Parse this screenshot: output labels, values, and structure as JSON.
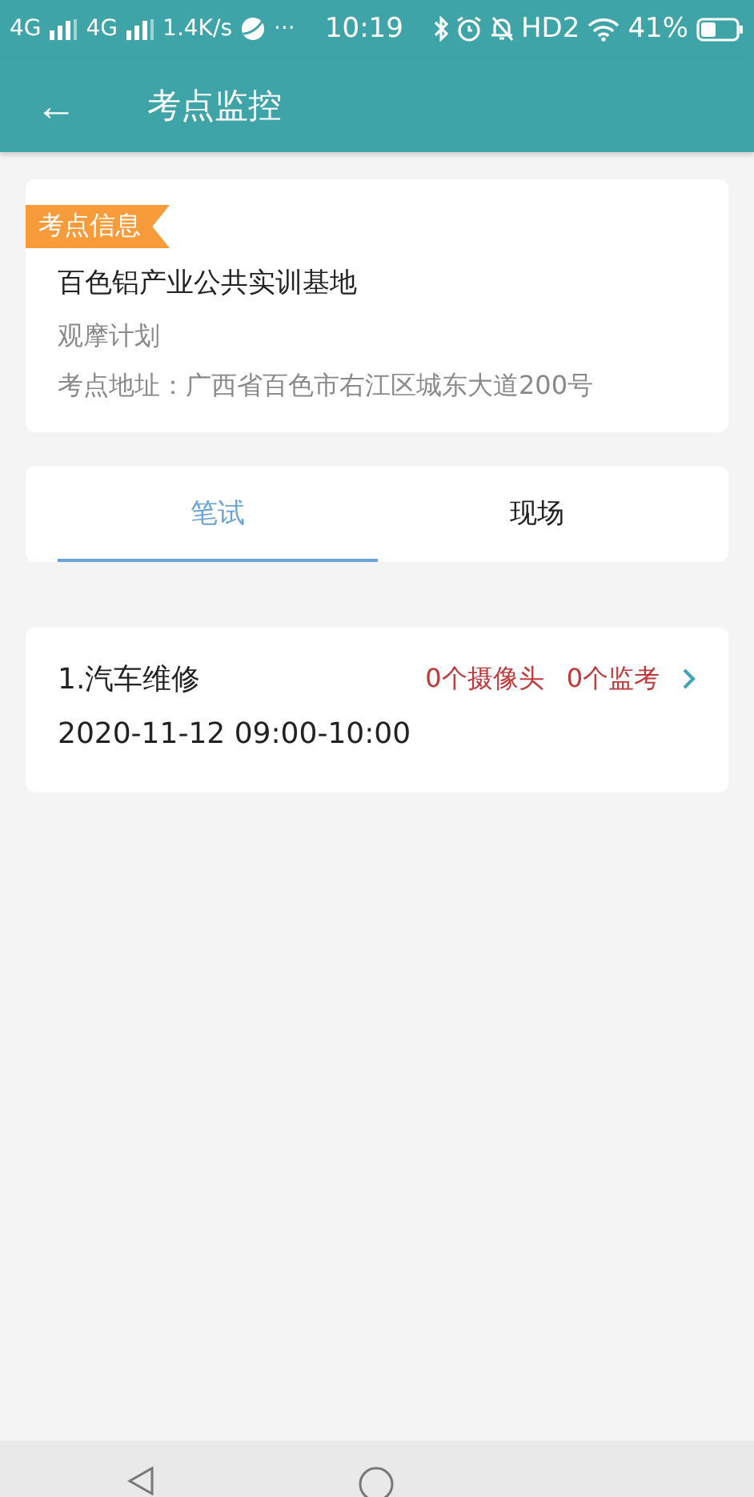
{
  "status_bar": {
    "left": [
      {
        "kind": "network",
        "text": "4G"
      },
      {
        "kind": "network",
        "text": "4G"
      },
      {
        "kind": "speed",
        "text": "1.4K/s"
      },
      {
        "kind": "more",
        "text": "···"
      }
    ],
    "time": "10:19",
    "right": [
      {
        "kind": "bluetooth"
      },
      {
        "kind": "alarm"
      },
      {
        "kind": "mute"
      },
      {
        "kind": "text",
        "text": "HD2"
      },
      {
        "kind": "wifi"
      },
      {
        "kind": "text",
        "text": "41%"
      },
      {
        "kind": "battery"
      }
    ]
  },
  "app_bar": {
    "back": "←",
    "title": "考点监控"
  },
  "site": {
    "tag": "考点信息",
    "name": "百色铝产业公共实训基地",
    "plan": "观摩计划",
    "address": "考点地址：广西省百色市右江区城东大道200号"
  },
  "tabs": [
    {
      "label": "笔试",
      "selected": true
    },
    {
      "label": "现场",
      "selected": false
    }
  ],
  "exams": [
    {
      "title": "1.汽车维修",
      "cameras": "0个摄像头",
      "proctors": "0个监考",
      "time": "2020-11-12 09:00-10:00"
    }
  ],
  "nav_bar": {
    "buttons": [
      {
        "kind": "back"
      },
      {
        "kind": "home"
      }
    ]
  }
}
